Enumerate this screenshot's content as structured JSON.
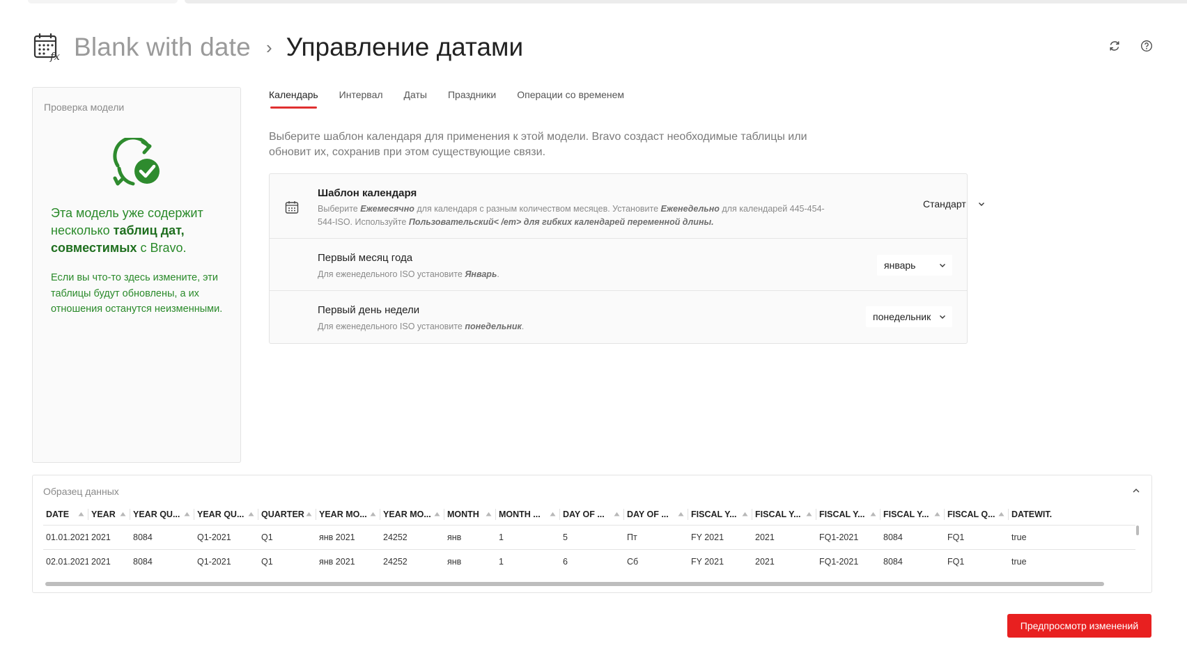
{
  "header": {
    "root": "Blank with date",
    "separator": "›",
    "title": "Управление датами",
    "logo_icon": "calendar-fx-icon",
    "actions": [
      {
        "icon": "refresh-icon"
      },
      {
        "icon": "help-icon"
      }
    ]
  },
  "left_panel": {
    "title": "Проверка модели",
    "status_icon": "sync-check-icon",
    "main_text_a": "Эта модель уже содержит несколько ",
    "main_text_b": "таблиц дат, совместимых",
    "main_text_c": " с Bravo.",
    "sub_text": "Если вы что-то здесь измените, эти таблицы будут обновлены, а их отношения останутся неизменными.",
    "accent_color": "#2a8a2a"
  },
  "tabs": [
    {
      "label": "Календарь",
      "active": true
    },
    {
      "label": "Интервал",
      "active": false
    },
    {
      "label": "Даты",
      "active": false
    },
    {
      "label": "Праздники",
      "active": false
    },
    {
      "label": "Операции со временем",
      "active": false
    }
  ],
  "description": "Выберите шаблон календаря для применения к этой модели. Bravo создаст необходимые таблицы или обновит их, сохранив при этом существующие связи.",
  "settings": [
    {
      "title": "Шаблон календаря",
      "icon": "calendar-icon",
      "help_a": "Выберите ",
      "help_b": "Ежемесячно",
      "help_c": " для календаря с разным количеством месяцев. Установите ",
      "help_d": "Еженедельно",
      "help_e": " для календарей 445-454-544-ISO. Используйте ",
      "help_f": "Пользовательский< /em> для гибких календарей переменной длины.",
      "value": "Стандарт"
    },
    {
      "title": "Первый месяц года",
      "help_a": "Для еженедельного ISO установите ",
      "help_b": "Январь",
      "help_c": ".",
      "value": "январь"
    },
    {
      "title": "Первый день недели",
      "help_a": "Для еженедельного ISO установите ",
      "help_b": "понедельник",
      "help_c": ".",
      "value": "понедельник"
    }
  ],
  "sample": {
    "title": "Образец данных",
    "columns": [
      "DATE",
      "YEAR",
      "YEAR QU...",
      "YEAR QU...",
      "QUARTER",
      "YEAR MO...",
      "YEAR MO...",
      "MONTH",
      "MONTH ...",
      "DAY OF ...",
      "DAY OF ...",
      "FISCAL Y...",
      "FISCAL Y...",
      "FISCAL Y...",
      "FISCAL Y...",
      "FISCAL Q...",
      "DATEWIT..."
    ],
    "rows": [
      [
        "01.01.2021",
        "2021",
        "8084",
        "Q1-2021",
        "Q1",
        "янв 2021",
        "24252",
        "янв",
        "1",
        "5",
        "Пт",
        "FY 2021",
        "2021",
        "FQ1-2021",
        "8084",
        "FQ1",
        "true"
      ],
      [
        "02.01.2021",
        "2021",
        "8084",
        "Q1-2021",
        "Q1",
        "янв 2021",
        "24252",
        "янв",
        "1",
        "6",
        "Сб",
        "FY 2021",
        "2021",
        "FQ1-2021",
        "8084",
        "FQ1",
        "true"
      ]
    ]
  },
  "preview_button": "Предпросмотр изменений",
  "colors": {
    "primary": "#e82020",
    "tab_indicator": "#e03030",
    "success": "#2a8a2a"
  }
}
